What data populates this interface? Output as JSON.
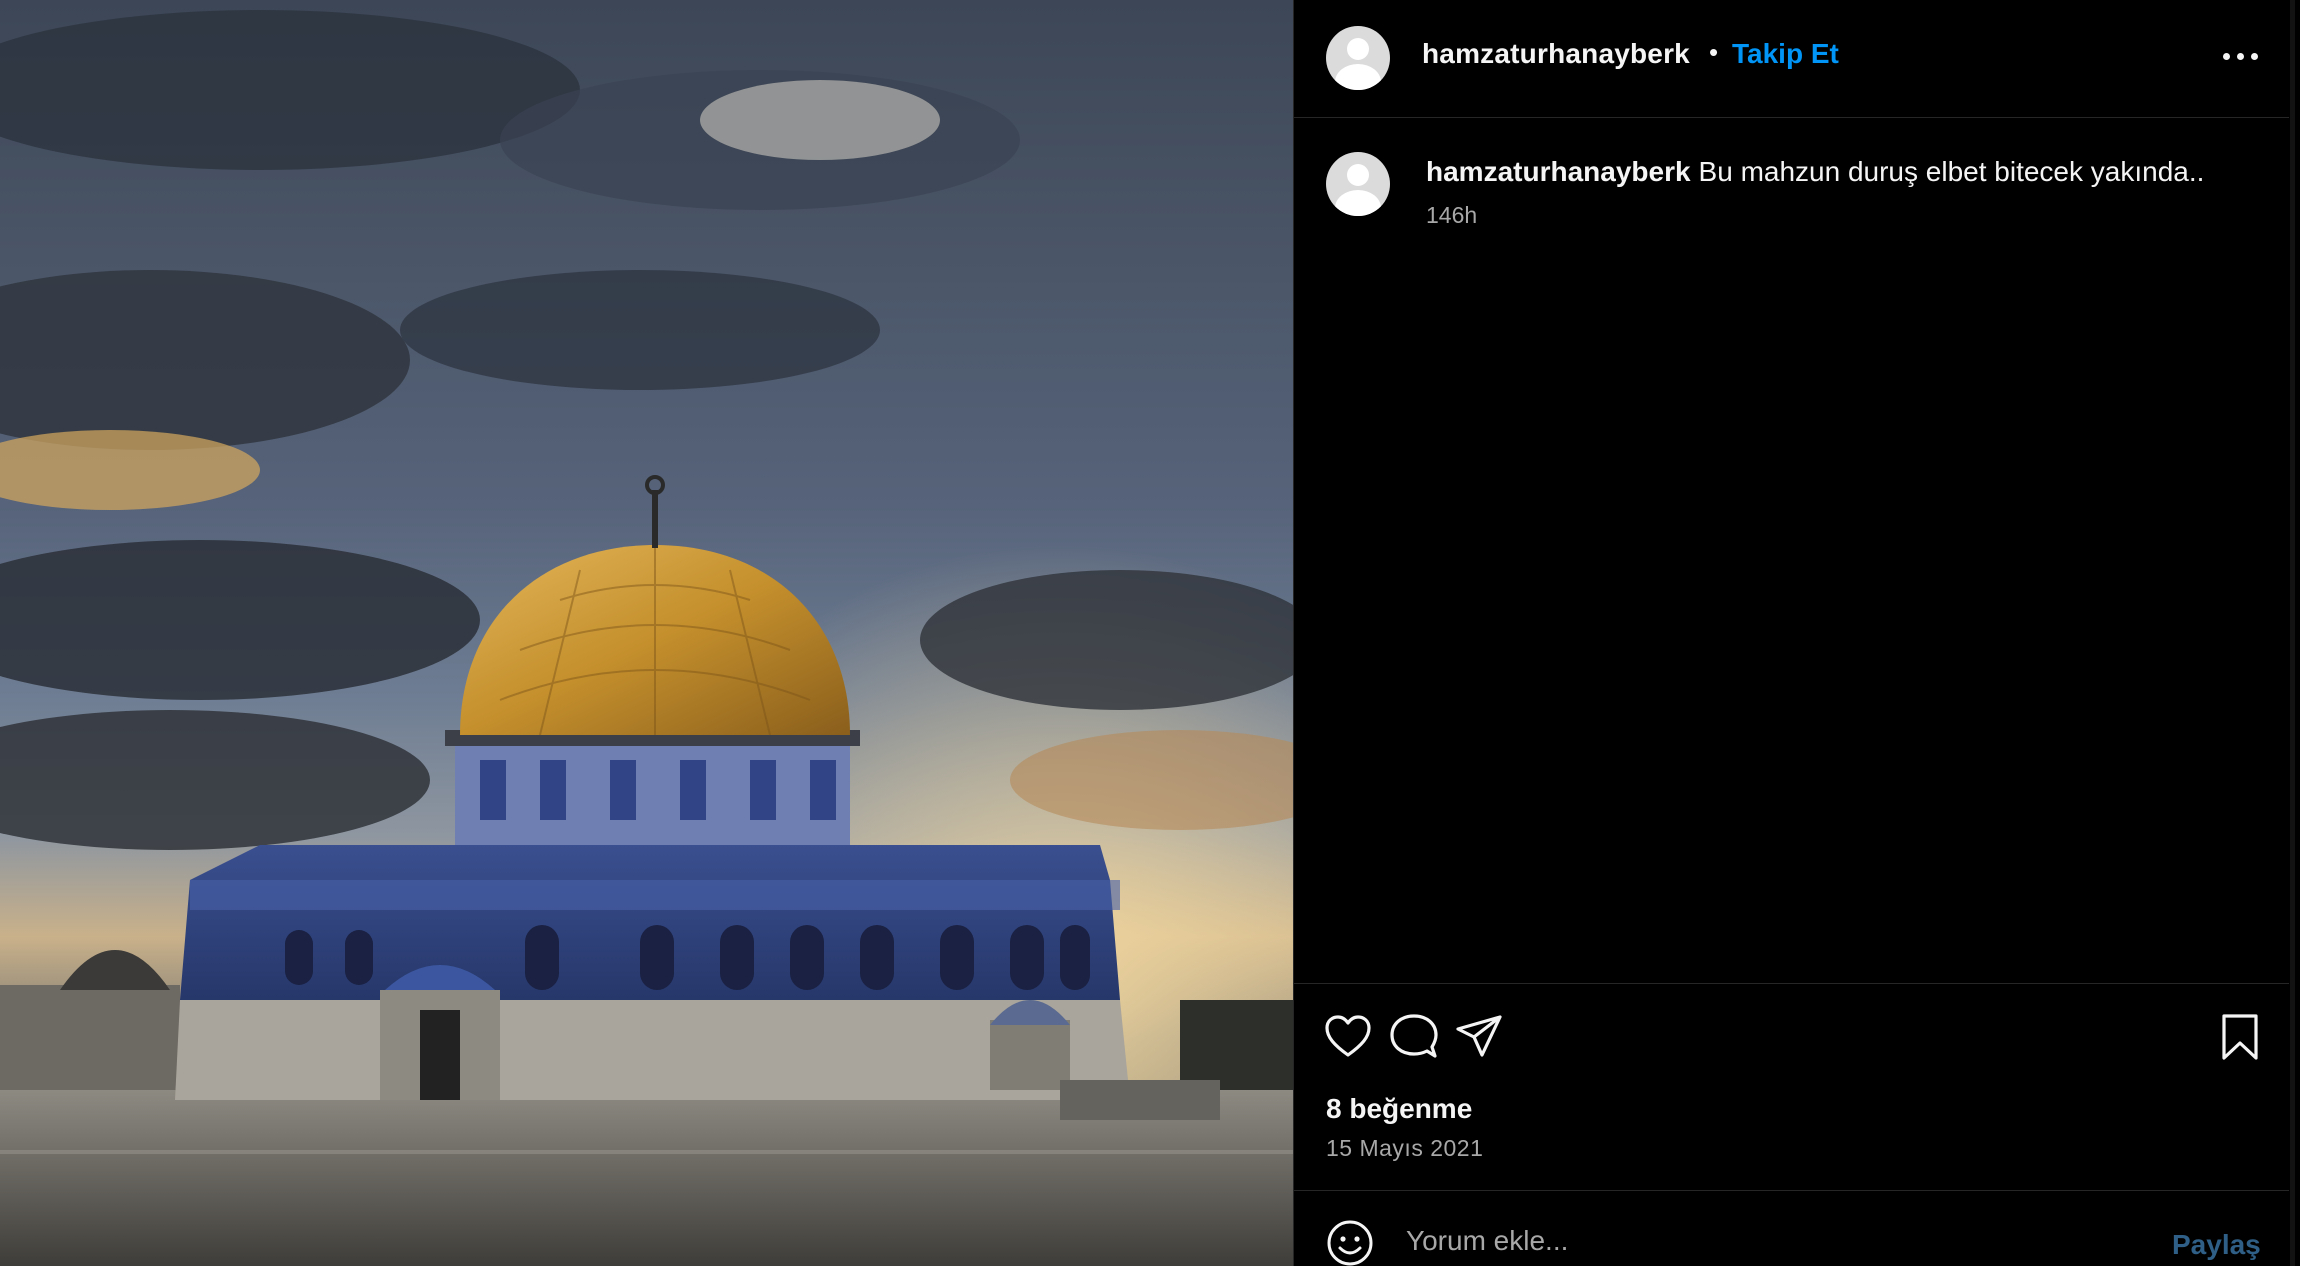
{
  "post": {
    "username": "hamzaturhanayberk",
    "separator": "•",
    "follow_label": "Takip Et",
    "caption_username": "hamzaturhanayberk",
    "caption_text": "Bu mahzun duruş elbet bitecek yakında..",
    "caption_time": "146h",
    "likes": "8 beğenme",
    "date": "15 Mayıs 2021"
  },
  "comment": {
    "placeholder": "Yorum ekle...",
    "submit_label": "Paylaş"
  },
  "icons": {
    "more": "more-options-icon",
    "like": "heart-icon",
    "comment": "comment-icon",
    "share": "send-icon",
    "save": "bookmark-icon",
    "emoji": "emoji-icon"
  },
  "colors": {
    "background": "#000000",
    "text": "#f5f5f5",
    "secondary_text": "#a8a8a8",
    "accent": "#0095f6",
    "divider": "#262626"
  }
}
